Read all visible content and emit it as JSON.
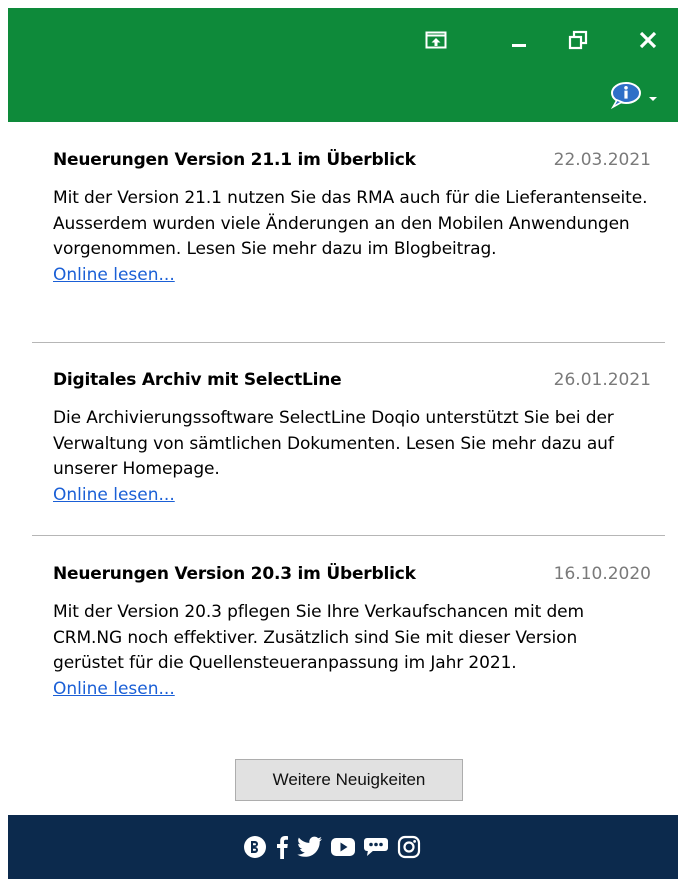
{
  "window": {
    "controls": [
      {
        "name": "pin-to-desktop-icon"
      },
      {
        "name": "minimize-icon"
      },
      {
        "name": "restore-icon"
      },
      {
        "name": "close-icon"
      }
    ],
    "info_icon": "info-bubble-icon"
  },
  "news": [
    {
      "title": "Neuerungen Version 21.1 im Überblick",
      "date": "22.03.2021",
      "body": "Mit der Version 21.1 nutzen Sie das RMA auch für die Lieferantenseite. Ausserdem wurden viele Änderungen an den Mobilen Anwendungen vorgenommen. Lesen Sie mehr dazu im Blogbeitrag.",
      "link": "Online lesen..."
    },
    {
      "title": "Digitales Archiv mit SelectLine",
      "date": "26.01.2021",
      "body": "Die Archivierungssoftware SelectLine Doqio unterstützt Sie bei der Verwaltung von sämtlichen Dokumenten. Lesen Sie mehr dazu auf unserer Homepage.",
      "link": "Online lesen..."
    },
    {
      "title": "Neuerungen Version 20.3 im Überblick",
      "date": "16.10.2020",
      "body": "Mit der Version 20.3 pflegen Sie Ihre Verkaufschancen mit dem CRM.NG noch effektiver. Zusätzlich sind Sie mit dieser Version gerüstet für die Quellensteueranpassung im Jahr 2021.",
      "link": "Online lesen..."
    }
  ],
  "more_button": "Weitere Neuigkeiten",
  "footer": {
    "social_icons": [
      "blog-icon",
      "facebook-icon",
      "twitter-icon",
      "youtube-icon",
      "forum-icon",
      "instagram-icon"
    ]
  },
  "colors": {
    "titlebar": "#0e8a3a",
    "footer": "#0c2a4d",
    "link": "#1a5fd6",
    "date": "#7a7a7a"
  }
}
